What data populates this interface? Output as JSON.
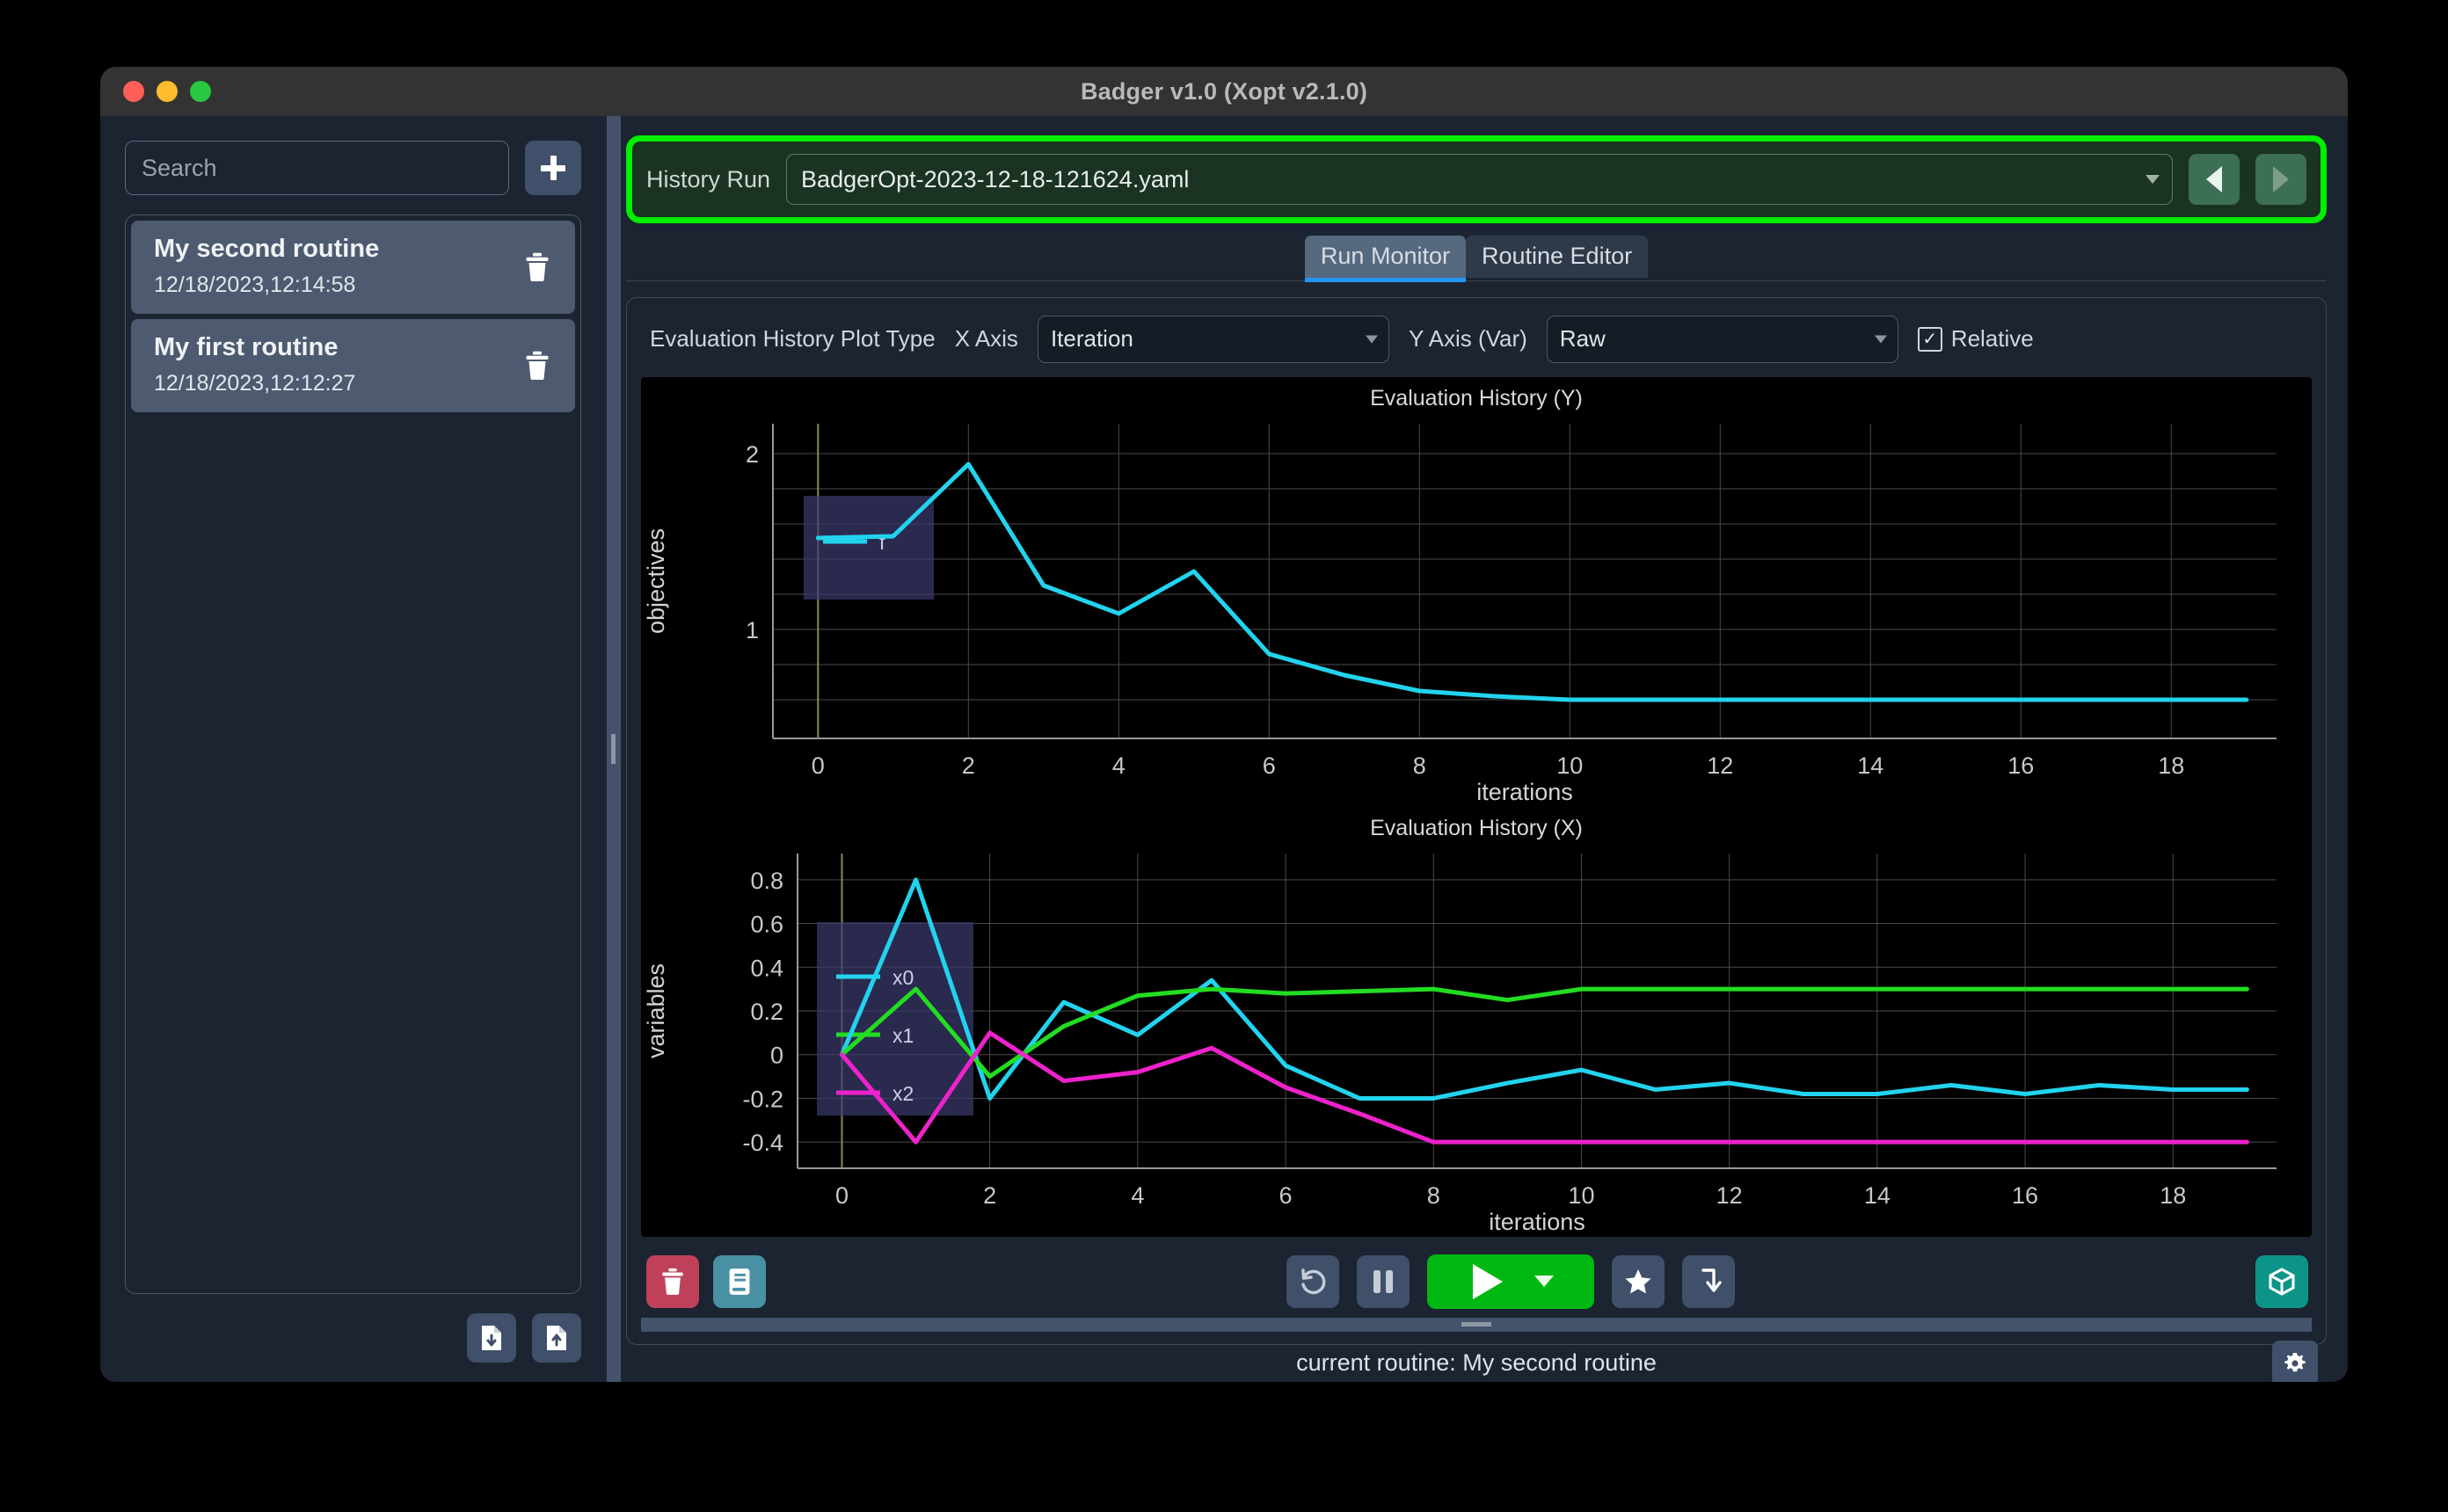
{
  "window": {
    "title": "Badger v1.0 (Xopt v2.1.0)",
    "traffic": {
      "close": "close-button",
      "minimize": "minimize-button",
      "zoom": "zoom-button"
    }
  },
  "sidebar": {
    "search": {
      "placeholder": "Search",
      "value": ""
    },
    "add_label": "+",
    "routines": [
      {
        "name": "My second routine",
        "timestamp": "12/18/2023,12:14:58"
      },
      {
        "name": "My first routine",
        "timestamp": "12/18/2023,12:12:27"
      }
    ],
    "import_label": "import-routine",
    "export_label": "export-routine"
  },
  "history": {
    "label": "History Run",
    "value": "BadgerOpt-2023-12-18-121624.yaml",
    "prev_label": "previous-run",
    "next_label": "next-run",
    "highlight_color": "#00ef00"
  },
  "tabs": [
    {
      "label": "Run Monitor",
      "active": true
    },
    {
      "label": "Routine Editor",
      "active": false
    }
  ],
  "controls": {
    "plot_type_label": "Evaluation History Plot Type",
    "x_axis_label": "X Axis",
    "x_axis_value": "Iteration",
    "y_axis_label": "Y Axis (Var)",
    "y_axis_value": "Raw",
    "relative_label": "Relative",
    "relative_checked": true,
    "checkmark": "✓"
  },
  "chart_data": [
    {
      "type": "line",
      "title": "Evaluation History (Y)",
      "xlabel": "iterations",
      "ylabel": "objectives",
      "xlim": [
        -0.6,
        19.4
      ],
      "ylim": [
        0.38,
        2.17
      ],
      "xticks": [
        0,
        2,
        4,
        6,
        8,
        10,
        12,
        14,
        16,
        18
      ],
      "yticks": [
        1,
        2
      ],
      "grid": true,
      "legend_position": "upper-left",
      "x": [
        0,
        1,
        2,
        3,
        4,
        5,
        6,
        7,
        8,
        9,
        10,
        11,
        12,
        13,
        14,
        15,
        16,
        17,
        18,
        19
      ],
      "series": [
        {
          "name": "f",
          "color": "#22d3ee",
          "values": [
            1.52,
            1.53,
            1.94,
            1.25,
            1.09,
            1.33,
            0.86,
            0.74,
            0.65,
            0.62,
            0.6,
            0.6,
            0.6,
            0.6,
            0.6,
            0.6,
            0.6,
            0.6,
            0.6,
            0.6
          ]
        }
      ]
    },
    {
      "type": "line",
      "title": "Evaluation History (X)",
      "xlabel": "iterations",
      "ylabel": "variables",
      "xlim": [
        -0.6,
        19.4
      ],
      "ylim": [
        -0.52,
        0.92
      ],
      "xticks": [
        0,
        2,
        4,
        6,
        8,
        10,
        12,
        14,
        16,
        18
      ],
      "yticks": [
        0.8,
        0.6,
        0.4,
        0.2,
        0,
        -0.2,
        -0.4
      ],
      "grid": true,
      "legend_position": "upper-left",
      "x": [
        0,
        1,
        2,
        3,
        4,
        5,
        6,
        7,
        8,
        9,
        10,
        11,
        12,
        13,
        14,
        15,
        16,
        17,
        18,
        19
      ],
      "series": [
        {
          "name": "x0",
          "color": "#22d3ee",
          "values": [
            0,
            0.8,
            -0.2,
            0.24,
            0.09,
            0.34,
            -0.05,
            -0.2,
            -0.2,
            -0.13,
            -0.07,
            -0.16,
            -0.13,
            -0.18,
            -0.18,
            -0.14,
            -0.18,
            -0.14,
            -0.16,
            -0.16
          ]
        },
        {
          "name": "x1",
          "color": "#22dd22",
          "values": [
            0,
            0.3,
            -0.1,
            0.13,
            0.27,
            0.3,
            0.28,
            0.29,
            0.3,
            0.25,
            0.3,
            0.3,
            0.3,
            0.3,
            0.3,
            0.3,
            0.3,
            0.3,
            0.3,
            0.3
          ]
        },
        {
          "name": "x2",
          "color": "#ee22cc",
          "values": [
            0,
            -0.4,
            0.1,
            -0.12,
            -0.08,
            0.03,
            -0.15,
            -0.27,
            -0.4,
            -0.4,
            -0.4,
            -0.4,
            -0.4,
            -0.4,
            -0.4,
            -0.4,
            -0.4,
            -0.4,
            -0.4,
            -0.4
          ]
        }
      ]
    }
  ],
  "toolbar": {
    "delete_label": "delete-run",
    "logbook_label": "send-to-logbook",
    "reset_label": "reset",
    "pause_label": "pause",
    "run_label": "run",
    "run_menu_label": "run-options",
    "optimal_label": "jump-to-optimum",
    "set_label": "set-to-current",
    "extension_label": "extensions"
  },
  "status": {
    "text": "current routine: My second routine",
    "settings_label": "settings"
  }
}
